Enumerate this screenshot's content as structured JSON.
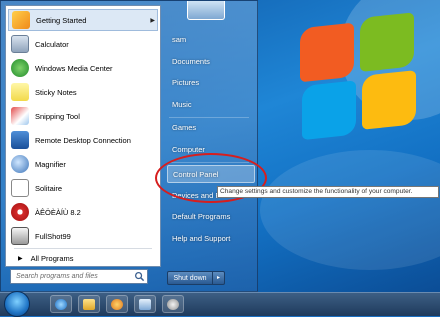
{
  "start_menu": {
    "left_items": [
      {
        "label": "Getting Started",
        "icon": "getting-started-icon",
        "has_submenu": true
      },
      {
        "label": "Calculator",
        "icon": "calculator-icon"
      },
      {
        "label": "Windows Media Center",
        "icon": "media-center-icon"
      },
      {
        "label": "Sticky Notes",
        "icon": "sticky-notes-icon"
      },
      {
        "label": "Snipping Tool",
        "icon": "snipping-tool-icon"
      },
      {
        "label": "Remote Desktop Connection",
        "icon": "remote-desktop-icon"
      },
      {
        "label": "Magnifier",
        "icon": "magnifier-icon"
      },
      {
        "label": "Solitaire",
        "icon": "solitaire-icon"
      },
      {
        "label": "ÀÊÖÈÀÍÙ 8.2",
        "icon": "app-icon"
      },
      {
        "label": "FullShot99",
        "icon": "fullshot-icon"
      }
    ],
    "all_programs": "All Programs",
    "search_placeholder": "Search programs and files",
    "right_items": [
      {
        "label": "sam"
      },
      {
        "label": "Documents"
      },
      {
        "label": "Pictures"
      },
      {
        "label": "Music"
      },
      {
        "label": "Games"
      },
      {
        "label": "Computer"
      },
      {
        "label": "Control Panel"
      },
      {
        "label": "Devices and P"
      },
      {
        "label": "Default Programs"
      },
      {
        "label": "Help and Support"
      }
    ],
    "shutdown_label": "Shut down",
    "shutdown_arrow": "▸"
  },
  "tooltip": "Change settings and customize the functionality of your computer.",
  "colors": {
    "highlight_circle": "#d61e1e",
    "selected_item_bg": "#dce8f5"
  }
}
